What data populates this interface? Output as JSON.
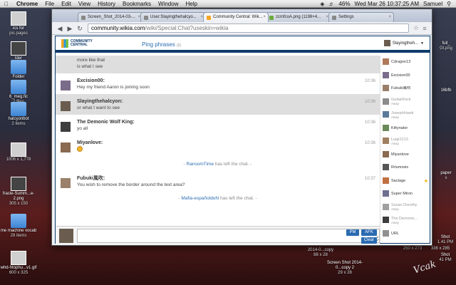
{
  "menubar": {
    "app": "Chrome",
    "items": [
      "File",
      "Edit",
      "View",
      "History",
      "Bookmarks",
      "Window",
      "Help"
    ],
    "battery": "46%",
    "clock": "Wed Mar 26  10:37:25 AM",
    "user": "Samuel"
  },
  "desktop_left": [
    {
      "name": "ics for",
      "sub": "pic.pages"
    },
    {
      "name": "lder",
      "sub": ""
    },
    {
      "name": "Folder",
      "sub": ""
    },
    {
      "name": "6_meg.fic",
      "sub": "2 files"
    },
    {
      "name": "halcyonbot",
      "sub": "2 items"
    },
    {
      "name": "",
      "sub": "1006 x 1,778"
    },
    {
      "name": "fracie-Summ...e-2.png",
      "sub": "305 x 150"
    },
    {
      "name": "me machine vocab",
      "sub": "28 items"
    },
    {
      "name": "whd-htophu...v1.gif",
      "sub": "600 x 325"
    }
  ],
  "desktop_right": [
    {
      "name": "full_",
      "sub": "Gt.png"
    },
    {
      "name": "16bfb",
      "sub": ""
    },
    {
      "name": "paper",
      "sub": "s"
    },
    {
      "name": "Shot",
      "sub": "1.41 PM"
    },
    {
      "name": "Shot",
      "sub": "41 PM"
    }
  ],
  "desktop_bottom": [
    {
      "name": "2014-0...copy",
      "sub": "88 x 28"
    },
    {
      "name": "Screen Shot 2014-0...copy 2",
      "sub": "29 x 28"
    },
    {
      "name": "",
      "sub": "250 x 273"
    },
    {
      "name": "",
      "sub": "336 x 285"
    }
  ],
  "signature": "Vcak",
  "tabs": [
    {
      "label": "Screen_Shot_2014-03-...",
      "active": false
    },
    {
      "label": "User:Slayingthehalcyo...",
      "active": false
    },
    {
      "label": "Community Central: Wik...",
      "active": true
    },
    {
      "label": "zcmfcoA.png (1198×4...",
      "active": false
    },
    {
      "label": "Settings",
      "active": false
    }
  ],
  "address": {
    "host": "community.wikia.com",
    "path": "/wiki/Special:Chat?useskin=wikia"
  },
  "chat": {
    "logo_line1": "COMMUNITY",
    "logo_line2": "CENTRAL",
    "ping_label": "Ping phrases",
    "ping_count": "(2)",
    "current_user": "Slayingtheh...",
    "messages": [
      {
        "type": "cont",
        "highlight": true,
        "lines": [
          "more like that",
          "is what I see"
        ]
      },
      {
        "type": "msg",
        "highlight": false,
        "name": "Excision00:",
        "text": "Hey my friend Aaron is joining soon",
        "time": "10:36"
      },
      {
        "type": "msg",
        "highlight": true,
        "name": "Slayingthehalcyon:",
        "text": "or what I want to see",
        "time": "10:36"
      },
      {
        "type": "msg",
        "highlight": false,
        "name": "The Demonic Wolf King:",
        "text": "yo all",
        "time": "10:36"
      },
      {
        "type": "msg",
        "highlight": false,
        "name": "Miyanlove:",
        "text": "",
        "emoji": true,
        "time": "10:36"
      },
      {
        "type": "inline",
        "who": "RansomTime",
        "text": "has left the chat."
      },
      {
        "type": "msg",
        "highlight": false,
        "name": "Fubuki風吹:",
        "text": "You wish to remove the border around the text area?",
        "time": "10:37"
      },
      {
        "type": "inline",
        "who": "Mafia-españoldoN",
        "text": "has left the chat."
      }
    ],
    "input_placeholder": "",
    "pm_label": "PM",
    "afk_label": "AFK",
    "clear_label": "Clear"
  },
  "users": [
    {
      "name": "Cdragon13",
      "status": "",
      "away": false
    },
    {
      "name": "Excision00",
      "status": "",
      "away": false
    },
    {
      "name": "Fubuki風吹",
      "status": "",
      "away": false
    },
    {
      "name": "GuitarRock",
      "status": "Away",
      "away": true
    },
    {
      "name": "JosephHawk",
      "status": "Away",
      "away": true
    },
    {
      "name": "Kittynator",
      "status": "",
      "away": false
    },
    {
      "name": "Luigi1213",
      "status": "Away",
      "away": true
    },
    {
      "name": "Miyanlove",
      "status": "",
      "away": false
    },
    {
      "name": "Rrismosis",
      "status": "",
      "away": false
    },
    {
      "name": "Sactage",
      "status": "",
      "away": false,
      "mod": true
    },
    {
      "name": "Super Miron",
      "status": "",
      "away": false
    },
    {
      "name": "Susan Dorothy",
      "status": "Away",
      "away": true
    },
    {
      "name": "The Demonic...",
      "status": "Away",
      "away": true
    },
    {
      "name": "URL",
      "status": "",
      "away": false
    }
  ]
}
